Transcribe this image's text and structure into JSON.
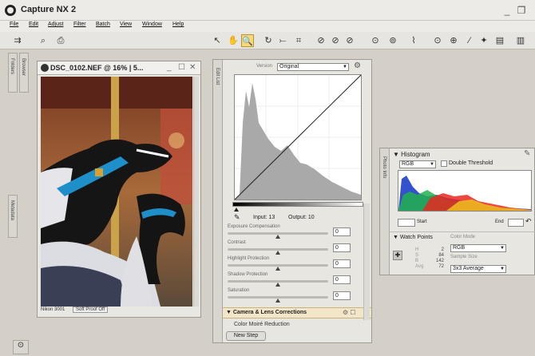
{
  "app": {
    "title": "Capture NX 2"
  },
  "window_controls": {
    "minimize": "_",
    "restore": "❐"
  },
  "menu": [
    "File",
    "Edit",
    "Adjust",
    "Filter",
    "Batch",
    "View",
    "Window",
    "Help"
  ],
  "left_tabs": {
    "browser": "Browser",
    "folders": "Folders",
    "metadata": "Metadata"
  },
  "image_window": {
    "title": "DSC_0102.NEF @ 16% | 5...",
    "status_left": "Nikon 3001",
    "status_mid": "Soft Proof Off"
  },
  "edit_list": {
    "tab": "Edit List",
    "picker_label": "Version",
    "picker_value": "Original",
    "input_label": "Input",
    "input_value": "13",
    "output_label": "Output",
    "output_value": "10",
    "sliders": [
      {
        "label": "Exposure Compensation",
        "value": "0"
      },
      {
        "label": "Contrast",
        "value": "0"
      },
      {
        "label": "Highlight Protection",
        "value": "0"
      },
      {
        "label": "Shadow Protection",
        "value": "0"
      },
      {
        "label": "Saturation",
        "value": "0"
      }
    ],
    "section_title": "Camera & Lens Corrections",
    "sub_item": "Color Moiré Reduction",
    "new_step": "New Step"
  },
  "histogram": {
    "tab": "Photo Info",
    "title": "Histogram",
    "channel": "RGB",
    "double_threshold": "Double Threshold",
    "start_label": "Start",
    "end_label": "End",
    "watch_points_title": "Watch Points",
    "color_mode_label": "Color Mode",
    "color_mode_value": "RGB",
    "sample_size_label": "Sample Size",
    "sample_size_value": "3x3 Average",
    "readout": [
      {
        "ch": "H",
        "val": "2"
      },
      {
        "ch": "S",
        "val": "84"
      },
      {
        "ch": "B",
        "val": "142"
      },
      {
        "ch": "Avg",
        "val": "72"
      }
    ]
  },
  "colors": {
    "accent_selected": "#f5d97a",
    "panel_bg": "#e8e6e1"
  }
}
